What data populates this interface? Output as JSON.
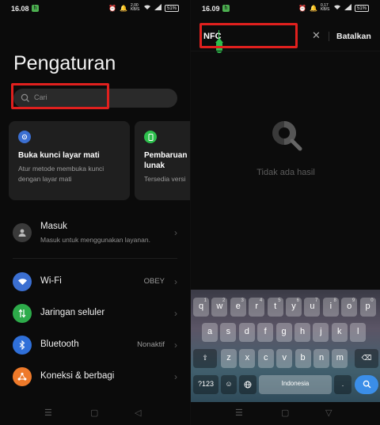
{
  "left": {
    "status": {
      "time": "16.08",
      "app_icon_glyph": "h",
      "right_icons": [
        "alarm-icon",
        "bell-icon",
        "data-speed-icon",
        "wifi-icon",
        "signal-icon",
        "battery-icon"
      ],
      "speed": "2,00 KB/S",
      "battery": "51%"
    },
    "title": "Pengaturan",
    "search": {
      "placeholder": "Cari"
    },
    "cards": [
      {
        "icon": "unlock-icon",
        "icon_color": "#3b6fd1",
        "title": "Buka kunci layar mati",
        "desc": "Atur metode membuka kunci dengan layar mati"
      },
      {
        "icon": "phone-update-icon",
        "icon_color": "#2dbf4c",
        "title": "Pembaruan lunak",
        "desc": "Tersedia versi"
      }
    ],
    "account": {
      "label": "Masuk",
      "desc": "Masuk untuk menggunakan layanan."
    },
    "items": [
      {
        "label": "Wi-Fi",
        "value": "OBEY",
        "icon": "wifi-icon",
        "color": "#3b6fd1"
      },
      {
        "label": "Jaringan seluler",
        "value": "",
        "icon": "cellular-icon",
        "color": "#2dab4a"
      },
      {
        "label": "Bluetooth",
        "value": "Nonaktif",
        "icon": "bluetooth-icon",
        "color": "#2f6fd8"
      },
      {
        "label": "Koneksi & berbagi",
        "value": "",
        "icon": "share-icon",
        "color": "#ee7a2a"
      }
    ],
    "nav": [
      "menu-icon",
      "home-icon",
      "back-icon"
    ]
  },
  "right": {
    "status": {
      "time": "16.09",
      "app_icon_glyph": "h",
      "speed": "0,17 KB/S",
      "battery": "51%"
    },
    "query": "NFC",
    "cancel": "Batalkan",
    "empty": "Tidak ada hasil",
    "keyboard": {
      "row1": [
        {
          "k": "q",
          "h": "1"
        },
        {
          "k": "w",
          "h": "2"
        },
        {
          "k": "e",
          "h": "3"
        },
        {
          "k": "r",
          "h": "4"
        },
        {
          "k": "t",
          "h": "5"
        },
        {
          "k": "y",
          "h": "6"
        },
        {
          "k": "u",
          "h": "7"
        },
        {
          "k": "i",
          "h": "8"
        },
        {
          "k": "o",
          "h": "9"
        },
        {
          "k": "p",
          "h": "0"
        }
      ],
      "row2": [
        "a",
        "s",
        "d",
        "f",
        "g",
        "h",
        "j",
        "k",
        "l"
      ],
      "row3": [
        "z",
        "x",
        "c",
        "v",
        "b",
        "n",
        "m"
      ],
      "shift": "⇧",
      "backspace": "⌫",
      "numbers": "?123",
      "emoji": "☺",
      "globe": "🌐",
      "space": "Indonesia",
      "period": ".",
      "go": "search-icon"
    },
    "nav": [
      "menu-icon",
      "home-icon",
      "hide-keyboard-icon"
    ]
  }
}
